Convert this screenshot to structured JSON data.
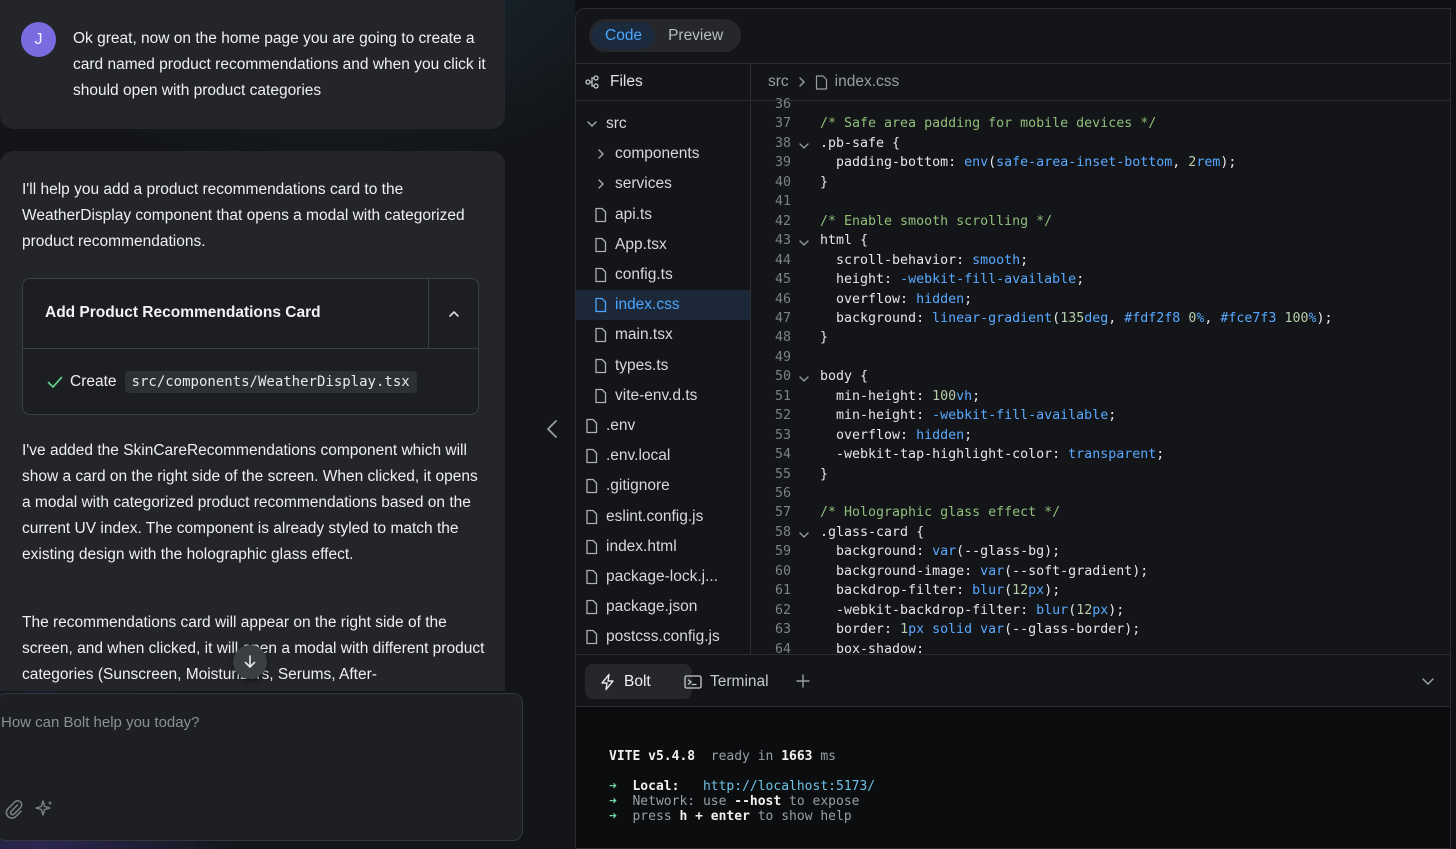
{
  "user_message": {
    "avatar_initial": "J",
    "text": "Ok great, now on the home page you are going to create a card named product recommendations and when you click it should open with product categories"
  },
  "assistant_message": {
    "intro": "I'll help you add a product recommendations card to the WeatherDisplay component that opens a modal with categorized product recommendations.",
    "artifact": {
      "title": "Add Product Recommendations Card",
      "action_label": "Create",
      "action_path": "src/components/WeatherDisplay.tsx"
    },
    "paragraph_2": "I've added the SkinCareRecommendations component which will show a card on the right side of the screen. When clicked, it opens a modal with categorized product recommendations based on the current UV index. The component is already styled to match the existing design with the holographic glass effect.",
    "paragraph_3": "The recommendations card will appear on the right side of the screen, and when clicked, it will open a modal with different product categories (Sunscreen, Moisturizers, Serums, After-"
  },
  "prompt": {
    "placeholder": "How can Bolt help you today?"
  },
  "workbench": {
    "tabs": [
      "Code",
      "Preview"
    ],
    "active_tab": "Code",
    "files_label": "Files",
    "breadcrumb": {
      "folder": "src",
      "file": "index.css"
    },
    "tree": [
      {
        "name": "src",
        "type": "folder-open",
        "depth": 0
      },
      {
        "name": "components",
        "type": "folder",
        "depth": 1
      },
      {
        "name": "services",
        "type": "folder",
        "depth": 1
      },
      {
        "name": "api.ts",
        "type": "file",
        "depth": 1
      },
      {
        "name": "App.tsx",
        "type": "file",
        "depth": 1
      },
      {
        "name": "config.ts",
        "type": "file",
        "depth": 1
      },
      {
        "name": "index.css",
        "type": "file",
        "depth": 1,
        "active": true
      },
      {
        "name": "main.tsx",
        "type": "file",
        "depth": 1
      },
      {
        "name": "types.ts",
        "type": "file",
        "depth": 1
      },
      {
        "name": "vite-env.d.ts",
        "type": "file",
        "depth": 1
      },
      {
        "name": ".env",
        "type": "file",
        "depth": 0
      },
      {
        "name": ".env.local",
        "type": "file",
        "depth": 0
      },
      {
        "name": ".gitignore",
        "type": "file",
        "depth": 0
      },
      {
        "name": "eslint.config.js",
        "type": "file",
        "depth": 0
      },
      {
        "name": "index.html",
        "type": "file",
        "depth": 0
      },
      {
        "name": "package-lock.j...",
        "type": "file",
        "depth": 0
      },
      {
        "name": "package.json",
        "type": "file",
        "depth": 0
      },
      {
        "name": "postcss.config.js",
        "type": "file",
        "depth": 0
      }
    ],
    "code": [
      {
        "n": "36",
        "fold": false,
        "tokens": []
      },
      {
        "n": "37",
        "fold": false,
        "tokens": [
          [
            "com",
            "/* Safe area padding for mobile devices */"
          ]
        ]
      },
      {
        "n": "38",
        "fold": true,
        "tokens": [
          [
            "sel",
            ".pb-safe {"
          ]
        ]
      },
      {
        "n": "39",
        "fold": false,
        "tokens": [
          [
            "prop",
            "  padding-bottom: "
          ],
          [
            "val",
            "env"
          ],
          [
            "pun",
            "("
          ],
          [
            "val",
            "safe-area-inset-bottom"
          ],
          [
            "pun",
            ", "
          ],
          [
            "num",
            "2"
          ],
          [
            "val",
            "rem"
          ],
          [
            "pun",
            ");"
          ]
        ]
      },
      {
        "n": "40",
        "fold": false,
        "tokens": [
          [
            "pun",
            "}"
          ]
        ]
      },
      {
        "n": "41",
        "fold": false,
        "tokens": []
      },
      {
        "n": "42",
        "fold": false,
        "tokens": [
          [
            "com",
            "/* Enable smooth scrolling */"
          ]
        ]
      },
      {
        "n": "43",
        "fold": true,
        "tokens": [
          [
            "sel",
            "html {"
          ]
        ]
      },
      {
        "n": "44",
        "fold": false,
        "tokens": [
          [
            "prop",
            "  scroll-behavior: "
          ],
          [
            "val",
            "smooth"
          ],
          [
            "pun",
            ";"
          ]
        ]
      },
      {
        "n": "45",
        "fold": false,
        "tokens": [
          [
            "prop",
            "  height: "
          ],
          [
            "val",
            "-webkit-fill-available"
          ],
          [
            "pun",
            ";"
          ]
        ]
      },
      {
        "n": "46",
        "fold": false,
        "tokens": [
          [
            "prop",
            "  overflow: "
          ],
          [
            "val",
            "hidden"
          ],
          [
            "pun",
            ";"
          ]
        ]
      },
      {
        "n": "47",
        "fold": false,
        "tokens": [
          [
            "prop",
            "  background: "
          ],
          [
            "val",
            "linear-gradient"
          ],
          [
            "pun",
            "("
          ],
          [
            "num",
            "135"
          ],
          [
            "val",
            "deg"
          ],
          [
            "pun",
            ", "
          ],
          [
            "val",
            "#fdf2f8"
          ],
          [
            "pun",
            " "
          ],
          [
            "num",
            "0"
          ],
          [
            "val",
            "%"
          ],
          [
            "pun",
            ", "
          ],
          [
            "val",
            "#fce7f3"
          ],
          [
            "pun",
            " "
          ],
          [
            "num",
            "100"
          ],
          [
            "val",
            "%"
          ],
          [
            "pun",
            ");"
          ]
        ]
      },
      {
        "n": "48",
        "fold": false,
        "tokens": [
          [
            "pun",
            "}"
          ]
        ]
      },
      {
        "n": "49",
        "fold": false,
        "tokens": []
      },
      {
        "n": "50",
        "fold": true,
        "tokens": [
          [
            "sel",
            "body {"
          ]
        ]
      },
      {
        "n": "51",
        "fold": false,
        "tokens": [
          [
            "prop",
            "  min-height: "
          ],
          [
            "num",
            "100"
          ],
          [
            "val",
            "vh"
          ],
          [
            "pun",
            ";"
          ]
        ]
      },
      {
        "n": "52",
        "fold": false,
        "tokens": [
          [
            "prop",
            "  min-height: "
          ],
          [
            "val",
            "-webkit-fill-available"
          ],
          [
            "pun",
            ";"
          ]
        ]
      },
      {
        "n": "53",
        "fold": false,
        "tokens": [
          [
            "prop",
            "  overflow: "
          ],
          [
            "val",
            "hidden"
          ],
          [
            "pun",
            ";"
          ]
        ]
      },
      {
        "n": "54",
        "fold": false,
        "tokens": [
          [
            "prop",
            "  -webkit-tap-highlight-color: "
          ],
          [
            "val",
            "transparent"
          ],
          [
            "pun",
            ";"
          ]
        ]
      },
      {
        "n": "55",
        "fold": false,
        "tokens": [
          [
            "pun",
            "}"
          ]
        ]
      },
      {
        "n": "56",
        "fold": false,
        "tokens": []
      },
      {
        "n": "57",
        "fold": false,
        "tokens": [
          [
            "com",
            "/* Holographic glass effect */"
          ]
        ]
      },
      {
        "n": "58",
        "fold": true,
        "tokens": [
          [
            "sel",
            ".glass-card {"
          ]
        ]
      },
      {
        "n": "59",
        "fold": false,
        "tokens": [
          [
            "prop",
            "  background: "
          ],
          [
            "val",
            "var"
          ],
          [
            "pun",
            "(--glass-bg);"
          ]
        ]
      },
      {
        "n": "60",
        "fold": false,
        "tokens": [
          [
            "prop",
            "  background-image: "
          ],
          [
            "val",
            "var"
          ],
          [
            "pun",
            "(--soft-gradient);"
          ]
        ]
      },
      {
        "n": "61",
        "fold": false,
        "tokens": [
          [
            "prop",
            "  backdrop-filter: "
          ],
          [
            "val",
            "blur"
          ],
          [
            "pun",
            "("
          ],
          [
            "num",
            "12"
          ],
          [
            "val",
            "px"
          ],
          [
            "pun",
            ");"
          ]
        ]
      },
      {
        "n": "62",
        "fold": false,
        "tokens": [
          [
            "prop",
            "  -webkit-backdrop-filter: "
          ],
          [
            "val",
            "blur"
          ],
          [
            "pun",
            "("
          ],
          [
            "num",
            "12"
          ],
          [
            "val",
            "px"
          ],
          [
            "pun",
            ");"
          ]
        ]
      },
      {
        "n": "63",
        "fold": false,
        "tokens": [
          [
            "prop",
            "  border: "
          ],
          [
            "num",
            "1"
          ],
          [
            "val",
            "px solid var"
          ],
          [
            "pun",
            "(--glass-border);"
          ]
        ]
      },
      {
        "n": "64",
        "fold": false,
        "tokens": [
          [
            "prop",
            "  box-shadow:"
          ]
        ]
      }
    ],
    "terminal_tabs": {
      "bolt": "Bolt",
      "terminal": "Terminal"
    },
    "terminal": {
      "vite_label": "VITE v5.4.8",
      "ready_text": "ready in",
      "ready_ms": "1663",
      "ms": "ms",
      "local_label": "Local:",
      "local_url": "http://localhost:5173/",
      "network_label": "Network:",
      "network_use": "use",
      "network_flag": "--host",
      "network_tail": "to expose",
      "help_press": "press",
      "help_key": "h + enter",
      "help_tail": "to show help"
    }
  },
  "colors": {
    "accent": "#4aa6ff",
    "avatar": "#7b6be0",
    "success": "#6fd3a0"
  }
}
